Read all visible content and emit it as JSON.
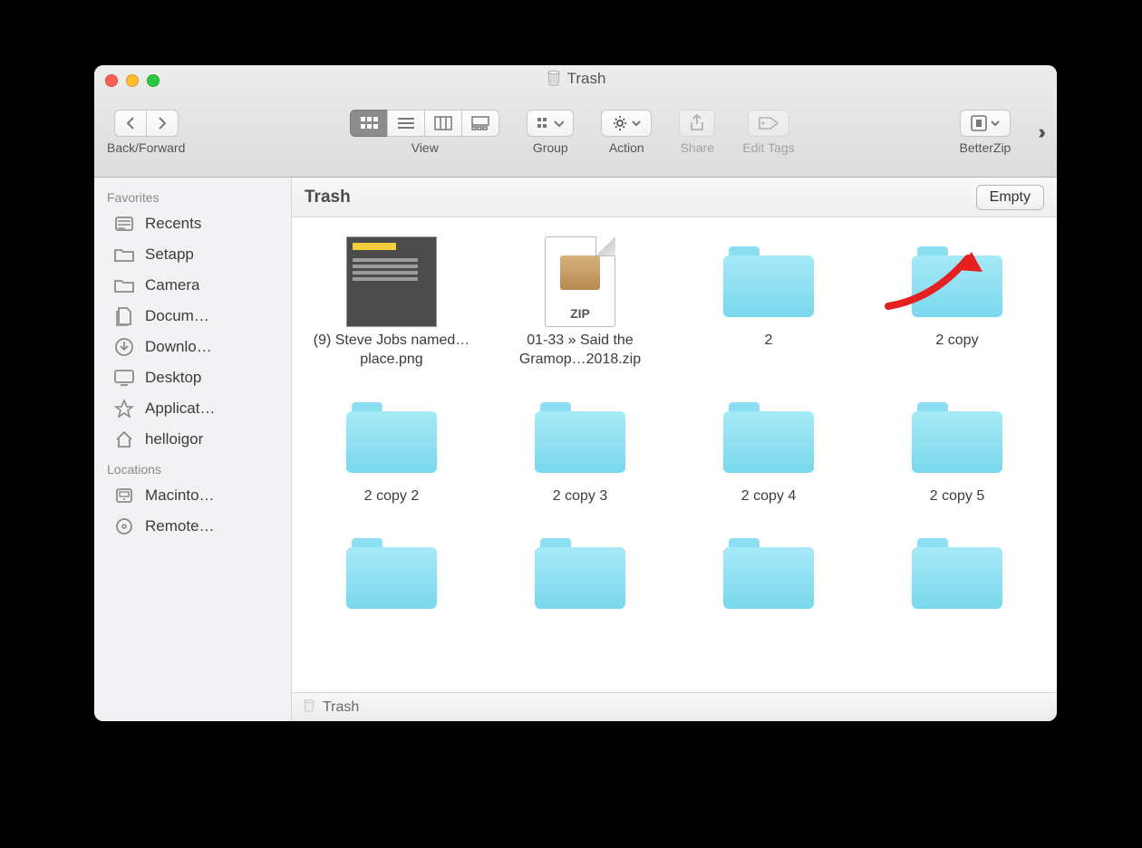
{
  "window_title": "Trash",
  "traffic": {
    "close": "close",
    "minimize": "minimize",
    "zoom": "zoom"
  },
  "toolbar": {
    "back_forward": "Back/Forward",
    "view": "View",
    "group": "Group",
    "action": "Action",
    "share": "Share",
    "edit_tags": "Edit Tags",
    "betterzip": "BetterZip"
  },
  "sidebar": {
    "favorites_header": "Favorites",
    "locations_header": "Locations",
    "favorites": [
      {
        "label": "Recents",
        "icon": "recents-icon"
      },
      {
        "label": "Setapp",
        "icon": "folder-icon"
      },
      {
        "label": "Camera",
        "icon": "folder-icon"
      },
      {
        "label": "Docum…",
        "icon": "documents-icon"
      },
      {
        "label": "Downlo…",
        "icon": "downloads-icon"
      },
      {
        "label": "Desktop",
        "icon": "desktop-icon"
      },
      {
        "label": "Applicat…",
        "icon": "applications-icon"
      },
      {
        "label": "helloigor",
        "icon": "home-icon"
      }
    ],
    "locations": [
      {
        "label": "Macinto…",
        "icon": "disk-icon"
      },
      {
        "label": "Remote…",
        "icon": "remote-disc-icon"
      }
    ]
  },
  "content": {
    "header": "Trash",
    "empty_button": "Empty",
    "items": [
      {
        "type": "image",
        "name": "(9) Steve Jobs named…place.png"
      },
      {
        "type": "zip",
        "name": "01-33 » Said the Gramop…2018.zip",
        "zip_label": "ZIP"
      },
      {
        "type": "folder",
        "name": "2"
      },
      {
        "type": "folder",
        "name": "2 copy"
      },
      {
        "type": "folder",
        "name": "2 copy 2"
      },
      {
        "type": "folder",
        "name": "2 copy 3"
      },
      {
        "type": "folder",
        "name": "2 copy 4"
      },
      {
        "type": "folder",
        "name": "2 copy 5"
      },
      {
        "type": "folder",
        "name": ""
      },
      {
        "type": "folder",
        "name": ""
      },
      {
        "type": "folder",
        "name": ""
      },
      {
        "type": "folder",
        "name": ""
      }
    ]
  },
  "pathbar": {
    "label": "Trash"
  },
  "annotation": {
    "arrow_color": "#e62020"
  }
}
